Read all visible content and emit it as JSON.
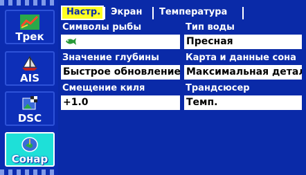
{
  "sidebar": {
    "items": [
      {
        "label": "Трек",
        "icon": "track-icon"
      },
      {
        "label": "AIS",
        "icon": "sailboat-icon"
      },
      {
        "label": "DSC",
        "icon": "dsc-icon"
      },
      {
        "label": "Сонар",
        "icon": "sonar-icon",
        "selected": true
      }
    ]
  },
  "tabs": [
    {
      "label": "Настр.",
      "active": true
    },
    {
      "label": "Экран",
      "active": false
    },
    {
      "label": "Температура",
      "active": false
    }
  ],
  "fields": {
    "fish_symbols": {
      "label": "Символы рыбы",
      "value_icon": "fish-icon"
    },
    "water_type": {
      "label": "Тип воды",
      "value": "Пресная"
    },
    "depth_value": {
      "label": "Значение глубины",
      "value": "Быстрое обновление"
    },
    "map_sonar": {
      "label": "Карта и данные сона",
      "value": "Максимальная детал"
    },
    "keel_offset": {
      "label": "Смещение киля",
      "value": "+1.0"
    },
    "transducer": {
      "label": "Трандсюсер",
      "value": "Темп."
    }
  },
  "colors": {
    "background": "#0a2aa8",
    "active_tab": "#ffff22",
    "selected_menu": "#1ee0d8",
    "field_bg": "#ffffff"
  }
}
